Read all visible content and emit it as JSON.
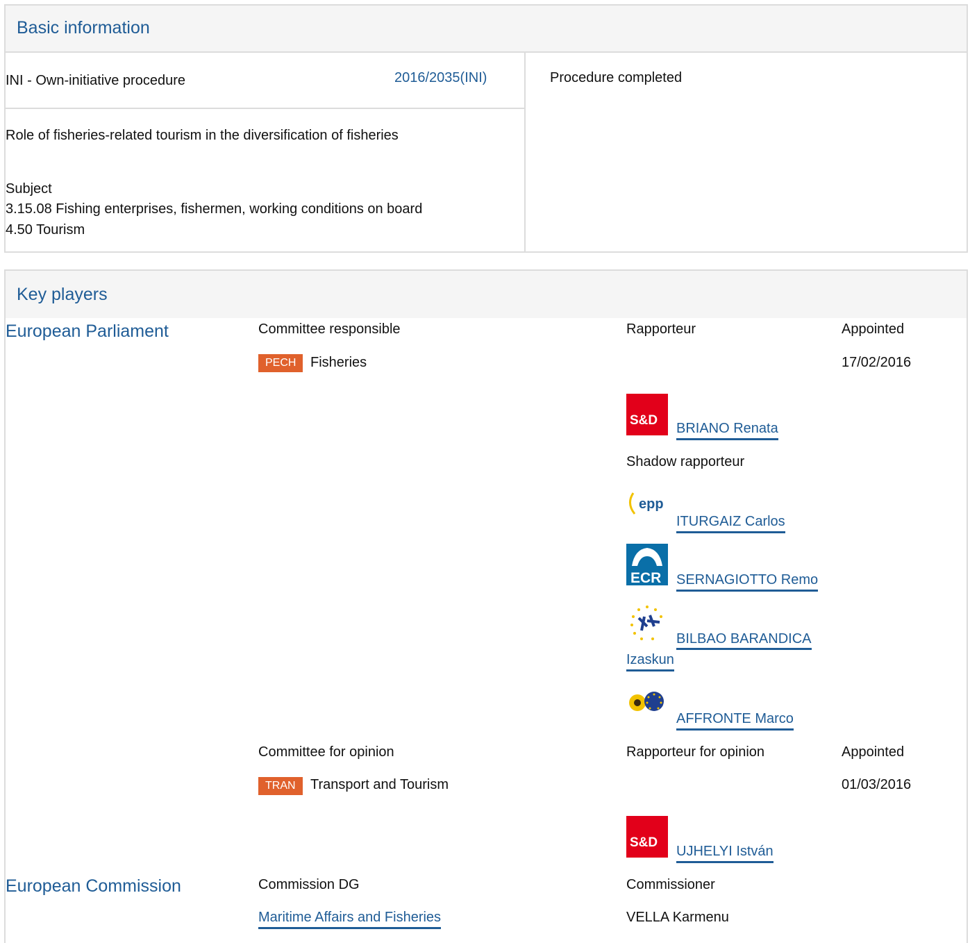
{
  "basic": {
    "title": "Basic information",
    "procedure_type": "INI - Own-initiative procedure",
    "procedure_ref": "2016/2035(INI)",
    "status": "Procedure completed",
    "description": "Role of fisheries-related tourism in the diversification of fisheries",
    "subject_label": "Subject",
    "subjects": [
      "3.15.08 Fishing enterprises, fishermen, working conditions on board",
      "4.50 Tourism"
    ]
  },
  "key_players": {
    "title": "Key players",
    "ep": {
      "label": "European Parliament",
      "committee_responsible_label": "Committee responsible",
      "rapporteur_label": "Rapporteur",
      "appointed_label": "Appointed",
      "committee_responsible": {
        "code": "PECH",
        "name": "Fisheries",
        "date": "17/02/2016"
      },
      "rapporteur": {
        "logo": "S&D",
        "name": "BRIANO Renata"
      },
      "shadow_label": "Shadow rapporteur",
      "shadows": [
        {
          "logo": "epp",
          "name": "ITURGAIZ Carlos"
        },
        {
          "logo": "ECR",
          "name": "SERNAGIOTTO Remo"
        },
        {
          "logo": "ALDE",
          "name_line1": "BILBAO BARANDICA",
          "name_line2": "Izaskun"
        },
        {
          "logo": "Greens/EFA",
          "name": "AFFRONTE Marco"
        }
      ],
      "opinion_label": "Committee for opinion",
      "rapporteur_opinion_label": "Rapporteur for opinion",
      "appointed_label2": "Appointed",
      "committee_opinion": {
        "code": "TRAN",
        "name": "Transport and Tourism",
        "date": "01/03/2016"
      },
      "opinion_rapporteur": {
        "logo": "S&D",
        "name": "UJHELYI István"
      }
    },
    "ec": {
      "label": "European Commission",
      "dg_label": "Commission DG",
      "commissioner_label": "Commissioner",
      "dg": "Maritime Affairs and Fisheries",
      "commissioner": "VELLA Karmenu"
    }
  },
  "colors": {
    "link": "#1f5c96",
    "tag": "#e0612c",
    "border": "#dcdcdc",
    "sd_red": "#e2001a",
    "ecr_blue": "#0a6fa8"
  }
}
